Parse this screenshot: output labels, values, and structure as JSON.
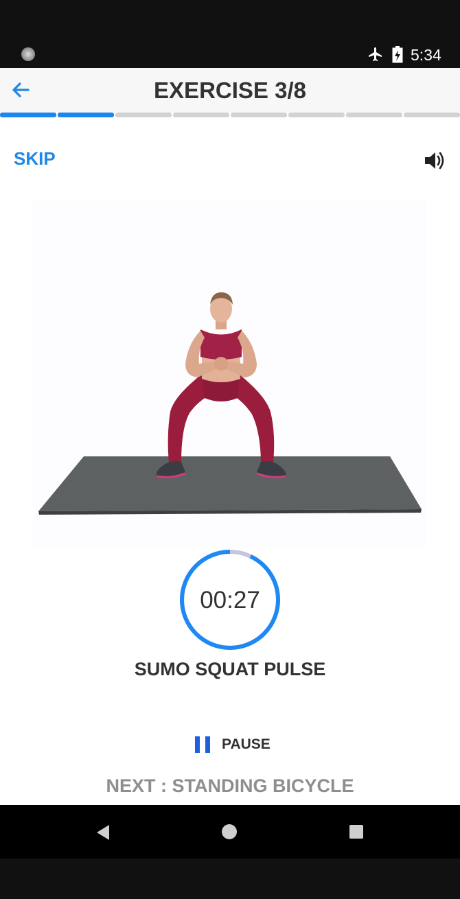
{
  "status_bar": {
    "time": "5:34",
    "icons": [
      "notification-dot-icon",
      "airplane-mode-icon",
      "battery-charging-icon"
    ]
  },
  "header": {
    "title": "EXERCISE 3/8",
    "back_icon": "arrow-left-icon"
  },
  "progress": {
    "total": 8,
    "completed": 2,
    "active_color": "#1e86ef",
    "inactive_color": "#d3d3d3"
  },
  "controls": {
    "skip_label": "SKIP",
    "sound_icon": "speaker-volume-icon"
  },
  "timer": {
    "value": "00:27",
    "remaining_fraction": 0.93,
    "ring_color": "#1e88f5",
    "elapsed_color": "#c5c5e0"
  },
  "exercise": {
    "name": "SUMO SQUAT PULSE"
  },
  "pause": {
    "label": "PAUSE",
    "icon": "pause-icon"
  },
  "next": {
    "label": "NEXT : STANDING BICYCLE"
  },
  "nav_bar": {
    "icons": [
      "nav-back-icon",
      "nav-home-icon",
      "nav-recents-icon"
    ]
  }
}
